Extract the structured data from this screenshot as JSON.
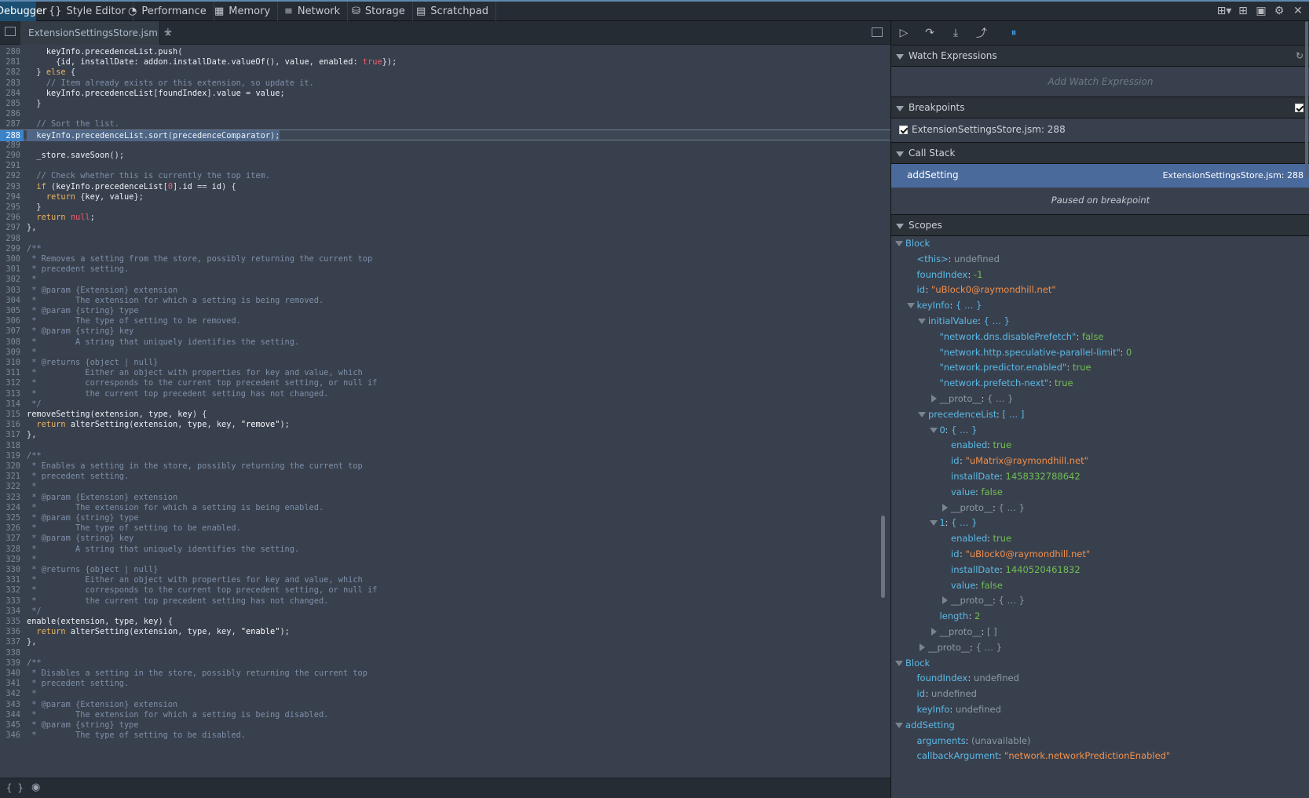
{
  "toolbar": {
    "tabs": [
      {
        "label": "Debugger",
        "icon": "debugger-icon"
      },
      {
        "label": "Style Editor",
        "icon": "braces-icon"
      },
      {
        "label": "Performance",
        "icon": "gauge-icon"
      },
      {
        "label": "Memory",
        "icon": "memory-icon"
      },
      {
        "label": "Network",
        "icon": "network-icon"
      },
      {
        "label": "Storage",
        "icon": "storage-icon"
      },
      {
        "label": "Scratchpad",
        "icon": "scratchpad-icon"
      }
    ]
  },
  "editor": {
    "file_tab": "ExtensionSettingsStore.jsm",
    "close_glyph": "×",
    "add_tab_glyph": "+",
    "current_line": "288",
    "lines": [
      {
        "n": "280",
        "t": "    keyInfo.precedenceList.push("
      },
      {
        "n": "281",
        "t": "      {id, installDate: addon.installDate.valueOf(), value, enabled: true});"
      },
      {
        "n": "282",
        "t": "  } else {"
      },
      {
        "n": "283",
        "t": "    // Item already exists or this extension, so update it."
      },
      {
        "n": "284",
        "t": "    keyInfo.precedenceList[foundIndex].value = value;"
      },
      {
        "n": "285",
        "t": "  }"
      },
      {
        "n": "286",
        "t": ""
      },
      {
        "n": "287",
        "t": "  // Sort the list."
      },
      {
        "n": "288",
        "t": "  keyInfo.precedenceList.sort(precedenceComparator);"
      },
      {
        "n": "289",
        "t": ""
      },
      {
        "n": "290",
        "t": "  _store.saveSoon();"
      },
      {
        "n": "291",
        "t": ""
      },
      {
        "n": "292",
        "t": "  // Check whether this is currently the top item."
      },
      {
        "n": "293",
        "t": "  if (keyInfo.precedenceList[0].id == id) {"
      },
      {
        "n": "294",
        "t": "    return {key, value};"
      },
      {
        "n": "295",
        "t": "  }"
      },
      {
        "n": "296",
        "t": "  return null;"
      },
      {
        "n": "297",
        "t": "},"
      },
      {
        "n": "298",
        "t": ""
      },
      {
        "n": "299",
        "t": "/**"
      },
      {
        "n": "300",
        "t": " * Removes a setting from the store, possibly returning the current top"
      },
      {
        "n": "301",
        "t": " * precedent setting."
      },
      {
        "n": "302",
        "t": " *"
      },
      {
        "n": "303",
        "t": " * @param {Extension} extension"
      },
      {
        "n": "304",
        "t": " *        The extension for which a setting is being removed."
      },
      {
        "n": "305",
        "t": " * @param {string} type"
      },
      {
        "n": "306",
        "t": " *        The type of setting to be removed."
      },
      {
        "n": "307",
        "t": " * @param {string} key"
      },
      {
        "n": "308",
        "t": " *        A string that uniquely identifies the setting."
      },
      {
        "n": "309",
        "t": " *"
      },
      {
        "n": "310",
        "t": " * @returns {object | null}"
      },
      {
        "n": "311",
        "t": " *          Either an object with properties for key and value, which"
      },
      {
        "n": "312",
        "t": " *          corresponds to the current top precedent setting, or null if"
      },
      {
        "n": "313",
        "t": " *          the current top precedent setting has not changed."
      },
      {
        "n": "314",
        "t": " */"
      },
      {
        "n": "315",
        "t": "removeSetting(extension, type, key) {"
      },
      {
        "n": "316",
        "t": "  return alterSetting(extension, type, key, \"remove\");"
      },
      {
        "n": "317",
        "t": "},"
      },
      {
        "n": "318",
        "t": ""
      },
      {
        "n": "319",
        "t": "/**"
      },
      {
        "n": "320",
        "t": " * Enables a setting in the store, possibly returning the current top"
      },
      {
        "n": "321",
        "t": " * precedent setting."
      },
      {
        "n": "322",
        "t": " *"
      },
      {
        "n": "323",
        "t": " * @param {Extension} extension"
      },
      {
        "n": "324",
        "t": " *        The extension for which a setting is being enabled."
      },
      {
        "n": "325",
        "t": " * @param {string} type"
      },
      {
        "n": "326",
        "t": " *        The type of setting to be enabled."
      },
      {
        "n": "327",
        "t": " * @param {string} key"
      },
      {
        "n": "328",
        "t": " *        A string that uniquely identifies the setting."
      },
      {
        "n": "329",
        "t": " *"
      },
      {
        "n": "330",
        "t": " * @returns {object | null}"
      },
      {
        "n": "331",
        "t": " *          Either an object with properties for key and value, which"
      },
      {
        "n": "332",
        "t": " *          corresponds to the current top precedent setting, or null if"
      },
      {
        "n": "333",
        "t": " *          the current top precedent setting has not changed."
      },
      {
        "n": "334",
        "t": " */"
      },
      {
        "n": "335",
        "t": "enable(extension, type, key) {"
      },
      {
        "n": "336",
        "t": "  return alterSetting(extension, type, key, \"enable\");"
      },
      {
        "n": "337",
        "t": "},"
      },
      {
        "n": "338",
        "t": ""
      },
      {
        "n": "339",
        "t": "/**"
      },
      {
        "n": "340",
        "t": " * Disables a setting in the store, possibly returning the current top"
      },
      {
        "n": "341",
        "t": " * precedent setting."
      },
      {
        "n": "342",
        "t": " *"
      },
      {
        "n": "343",
        "t": " * @param {Extension} extension"
      },
      {
        "n": "344",
        "t": " *        The extension for which a setting is being disabled."
      },
      {
        "n": "345",
        "t": " * @param {string} type"
      },
      {
        "n": "346",
        "t": " *        The type of setting to be disabled."
      }
    ]
  },
  "sidebar": {
    "watch": {
      "title": "Watch Expressions",
      "placeholder": "Add Watch Expression"
    },
    "breakpoints": {
      "title": "Breakpoints",
      "item": "ExtensionSettingsStore.jsm: 288"
    },
    "callstack": {
      "title": "Call Stack",
      "frame": "addSetting",
      "location": "ExtensionSettingsStore.jsm: 288",
      "status": "Paused on breakpoint"
    },
    "scopes": {
      "title": "Scopes",
      "rows": [
        {
          "d": 0,
          "exp": "open",
          "k": "Block",
          "kc": "sb"
        },
        {
          "d": 1,
          "k": "<this>",
          "v": "undefined",
          "vc": "su"
        },
        {
          "d": 1,
          "k": "foundIndex",
          "v": "-1",
          "vc": "sv"
        },
        {
          "d": 1,
          "k": "id",
          "v": "\"uBlock0@raymondhill.net\"",
          "vc": "ss"
        },
        {
          "d": 1,
          "exp": "open",
          "k": "keyInfo",
          "v": "{ … }",
          "vc": "sn"
        },
        {
          "d": 2,
          "exp": "open",
          "k": "initialValue",
          "v": "{ … }",
          "vc": "sn"
        },
        {
          "d": 3,
          "k": "\"network.dns.disablePrefetch\"",
          "v": "false",
          "vc": "sv"
        },
        {
          "d": 3,
          "k": "\"network.http.speculative-parallel-limit\"",
          "v": "0",
          "vc": "sv"
        },
        {
          "d": 3,
          "k": "\"network.predictor.enabled\"",
          "v": "true",
          "vc": "sv"
        },
        {
          "d": 3,
          "k": "\"network.prefetch-next\"",
          "v": "true",
          "vc": "sv"
        },
        {
          "d": 3,
          "exp": "closed",
          "k": "__proto__",
          "v": "{ … }",
          "vc": "su",
          "kc": "su"
        },
        {
          "d": 2,
          "exp": "open",
          "k": "precedenceList",
          "v": "[ … ]",
          "vc": "sn"
        },
        {
          "d": 3,
          "exp": "open",
          "k": "0",
          "v": "{ … }",
          "vc": "sn"
        },
        {
          "d": 4,
          "k": "enabled",
          "v": "true",
          "vc": "sv"
        },
        {
          "d": 4,
          "k": "id",
          "v": "\"uMatrix@raymondhill.net\"",
          "vc": "ss"
        },
        {
          "d": 4,
          "k": "installDate",
          "v": "1458332788642",
          "vc": "sv"
        },
        {
          "d": 4,
          "k": "value",
          "v": "false",
          "vc": "sv"
        },
        {
          "d": 4,
          "exp": "closed",
          "k": "__proto__",
          "v": "{ … }",
          "vc": "su",
          "kc": "su"
        },
        {
          "d": 3,
          "exp": "open",
          "k": "1",
          "v": "{ … }",
          "vc": "sn"
        },
        {
          "d": 4,
          "k": "enabled",
          "v": "true",
          "vc": "sv"
        },
        {
          "d": 4,
          "k": "id",
          "v": "\"uBlock0@raymondhill.net\"",
          "vc": "ss"
        },
        {
          "d": 4,
          "k": "installDate",
          "v": "1440520461832",
          "vc": "sv"
        },
        {
          "d": 4,
          "k": "value",
          "v": "false",
          "vc": "sv"
        },
        {
          "d": 4,
          "exp": "closed",
          "k": "__proto__",
          "v": "{ … }",
          "vc": "su",
          "kc": "su"
        },
        {
          "d": 3,
          "k": "length",
          "v": "2",
          "vc": "sv"
        },
        {
          "d": 3,
          "exp": "closed",
          "k": "__proto__",
          "v": "[ ]",
          "vc": "su",
          "kc": "su"
        },
        {
          "d": 2,
          "exp": "closed",
          "k": "__proto__",
          "v": "{ … }",
          "vc": "su",
          "kc": "su"
        },
        {
          "d": 0,
          "exp": "open",
          "k": "Block",
          "kc": "sb"
        },
        {
          "d": 1,
          "k": "foundIndex",
          "v": "undefined",
          "vc": "su"
        },
        {
          "d": 1,
          "k": "id",
          "v": "undefined",
          "vc": "su"
        },
        {
          "d": 1,
          "k": "keyInfo",
          "v": "undefined",
          "vc": "su"
        },
        {
          "d": 0,
          "exp": "open",
          "k": "addSetting",
          "kc": "sb"
        },
        {
          "d": 1,
          "k": "arguments",
          "v": "(unavailable)",
          "vc": "su"
        },
        {
          "d": 1,
          "k": "callbackArgument",
          "v": "\"network.networkPredictionEnabled\"",
          "vc": "ss"
        }
      ]
    }
  },
  "colors": {
    "accent": "#1d4f73",
    "selected_frame": "#4a6a9c",
    "breakpoint_marker": "#3b82c8"
  }
}
